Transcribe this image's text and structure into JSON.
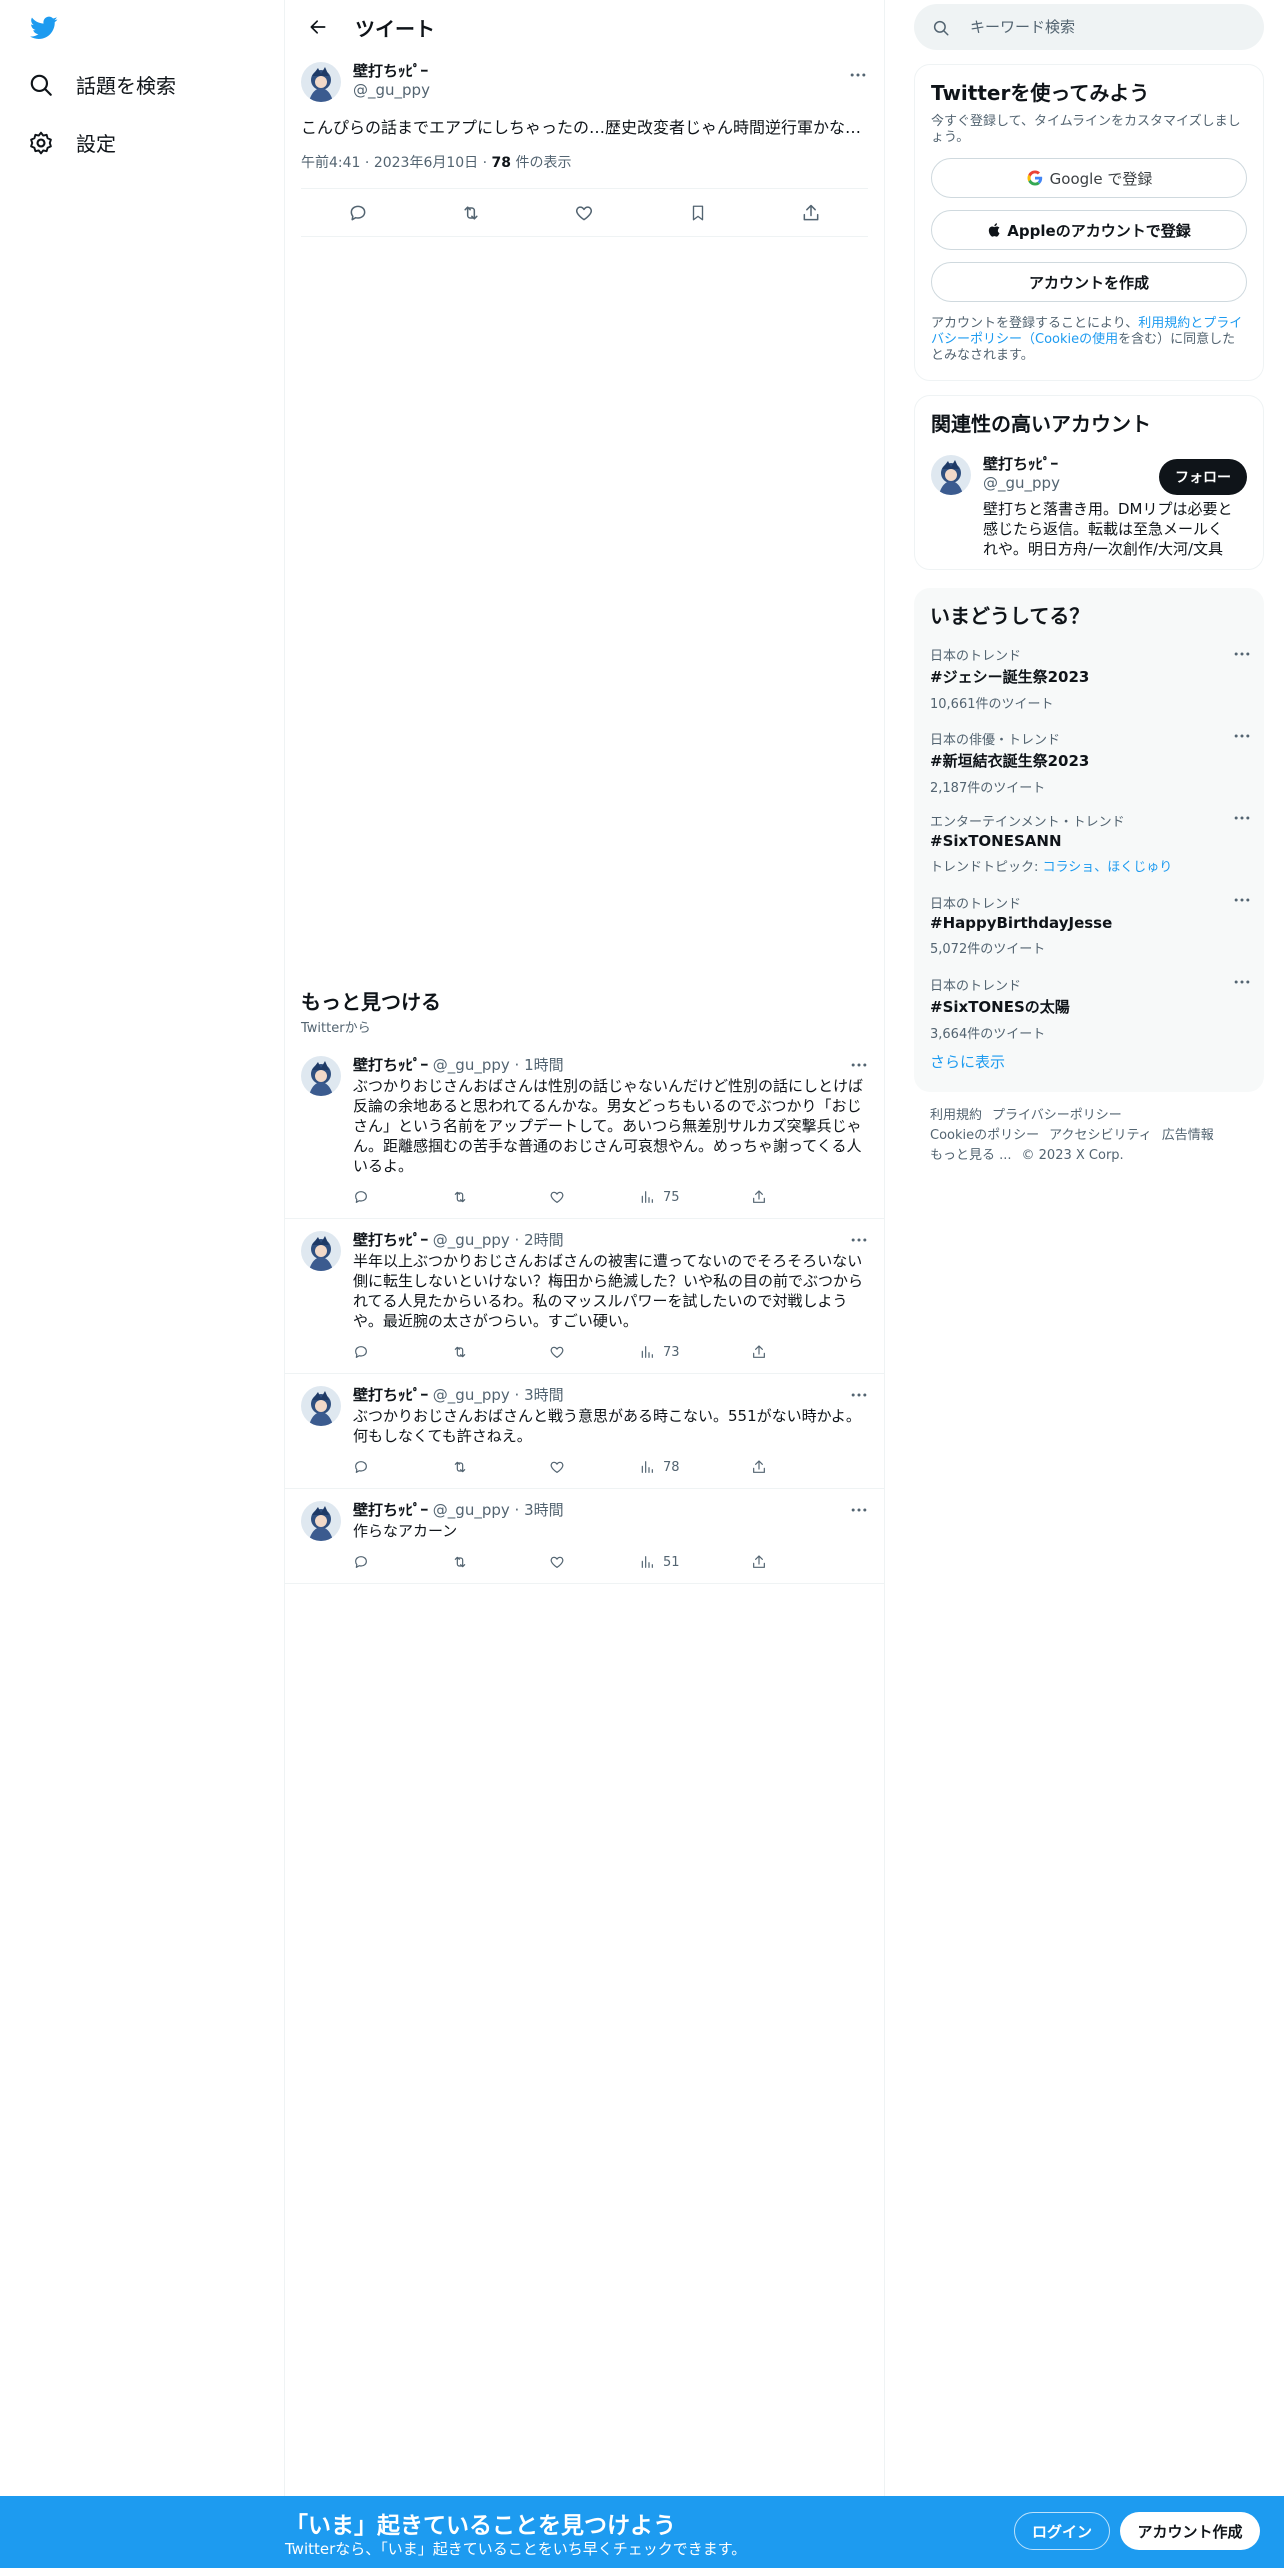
{
  "colors": {
    "accent": "#1d9bf0",
    "text": "#0f1419",
    "muted": "#536471"
  },
  "nav": {
    "logo_icon": "twitter-bird-icon",
    "items": [
      {
        "label": "話題を検索",
        "icon": "search-icon"
      },
      {
        "label": "設定",
        "icon": "gear-icon"
      }
    ]
  },
  "header": {
    "title": "ツイート"
  },
  "tweet": {
    "author_name": "壁打ちｯﾋﾟｰ",
    "author_handle": "@_gu_ppy",
    "text": "こんぴらの話までエアプにしちゃったの…歴史改変者じゃん時間逆行軍かな…",
    "time": "午前4:41",
    "date": "2023年6月10日",
    "views_count": "78",
    "views_label": "件の表示"
  },
  "more": {
    "title": "もっと見つける",
    "subtitle": "Twitterから"
  },
  "feed": [
    {
      "name": "壁打ちｯﾋﾟｰ",
      "handle": "@_gu_ppy",
      "time": "1時間",
      "text": "ぶつかりおじさんおばさんは性別の話じゃないんだけど性別の話にしとけば反論の余地あると思われてるんかな。男女どっちもいるのでぶつかり「おじさん」という名前をアップデートして。あいつら無差別サルカズ突撃兵じゃん。距離感掴むの苦手な普通のおじさん可哀想やん。めっちゃ謝ってくる人いるよ。",
      "views": "75"
    },
    {
      "name": "壁打ちｯﾋﾟｰ",
      "handle": "@_gu_ppy",
      "time": "2時間",
      "text": "半年以上ぶつかりおじさんおばさんの被害に遭ってないのでそろそろいない側に転生しないといけない？梅田から絶滅した？いや私の目の前でぶつかられてる人見たからいるわ。私のマッスルパワーを試したいので対戦しようや。最近腕の太さがつらい。すごい硬い。",
      "views": "73"
    },
    {
      "name": "壁打ちｯﾋﾟｰ",
      "handle": "@_gu_ppy",
      "time": "3時間",
      "text": "ぶつかりおじさんおばさんと戦う意思がある時こない。551がない時かよ。何もしなくても許さねえ。",
      "views": "78"
    },
    {
      "name": "壁打ちｯﾋﾟｰ",
      "handle": "@_gu_ppy",
      "time": "3時間",
      "text": "作らなアカーン",
      "views": "51"
    }
  ],
  "search": {
    "placeholder": "キーワード検索"
  },
  "signup": {
    "title": "Twitterを使ってみよう",
    "subtitle": "今すぐ登録して、タイムラインをカスタマイズしましょう。",
    "google_label": "Google で登録",
    "apple_label": "Appleのアカウントで登録",
    "create_label": "アカウントを作成",
    "terms_prefix": "アカウントを登録することにより、",
    "terms_link1": "利用規約",
    "terms_and": "と",
    "terms_link2": "プライバシーポリシー（Cookieの使用",
    "terms_suffix": "を含む）に同意したとみなされます。"
  },
  "relevant": {
    "title": "関連性の高いアカウント",
    "name": "壁打ちｯﾋﾟｰ",
    "handle": "@_gu_ppy",
    "follow_label": "フォロー",
    "bio": "壁打ちと落書き用。DMリプは必要と感じたら返信。転載は至急メールくれや。明日方舟/一次創作/大河/文具"
  },
  "trends": {
    "title": "いまどうしてる？",
    "items": [
      {
        "context": "日本のトレンド",
        "name": "#ジェシー誕生祭2023",
        "count": "10,661件のツイート"
      },
      {
        "context": "日本の俳優・トレンド",
        "name": "#新垣結衣誕生祭2023",
        "count": "2,187件のツイート"
      },
      {
        "context": "エンターテインメント・トレンド",
        "name": "#SixTONESANN",
        "count_prefix": "トレンドトピック: ",
        "count_link": "コラショ、ほくじゅり"
      },
      {
        "context": "日本のトレンド",
        "name": "#HappyBirthdayJesse",
        "count": "5,072件のツイート"
      },
      {
        "context": "日本のトレンド",
        "name": "#SixTONESの太陽",
        "count": "3,664件のツイート"
      }
    ],
    "show_more": "さらに表示"
  },
  "footer": {
    "terms": "利用規約",
    "privacy": "プライバシーポリシー",
    "cookie": "Cookieのポリシー",
    "accessibility": "アクセシビリティ",
    "ads": "広告情報",
    "more": "もっと見る ...",
    "copyright": "© 2023 X Corp."
  },
  "bottom_bar": {
    "title": "「いま」起きていることを見つけよう",
    "subtitle": "Twitterなら、「いま」起きていることをいち早くチェックできます。",
    "login_label": "ログイン",
    "create_label": "アカウント作成"
  }
}
